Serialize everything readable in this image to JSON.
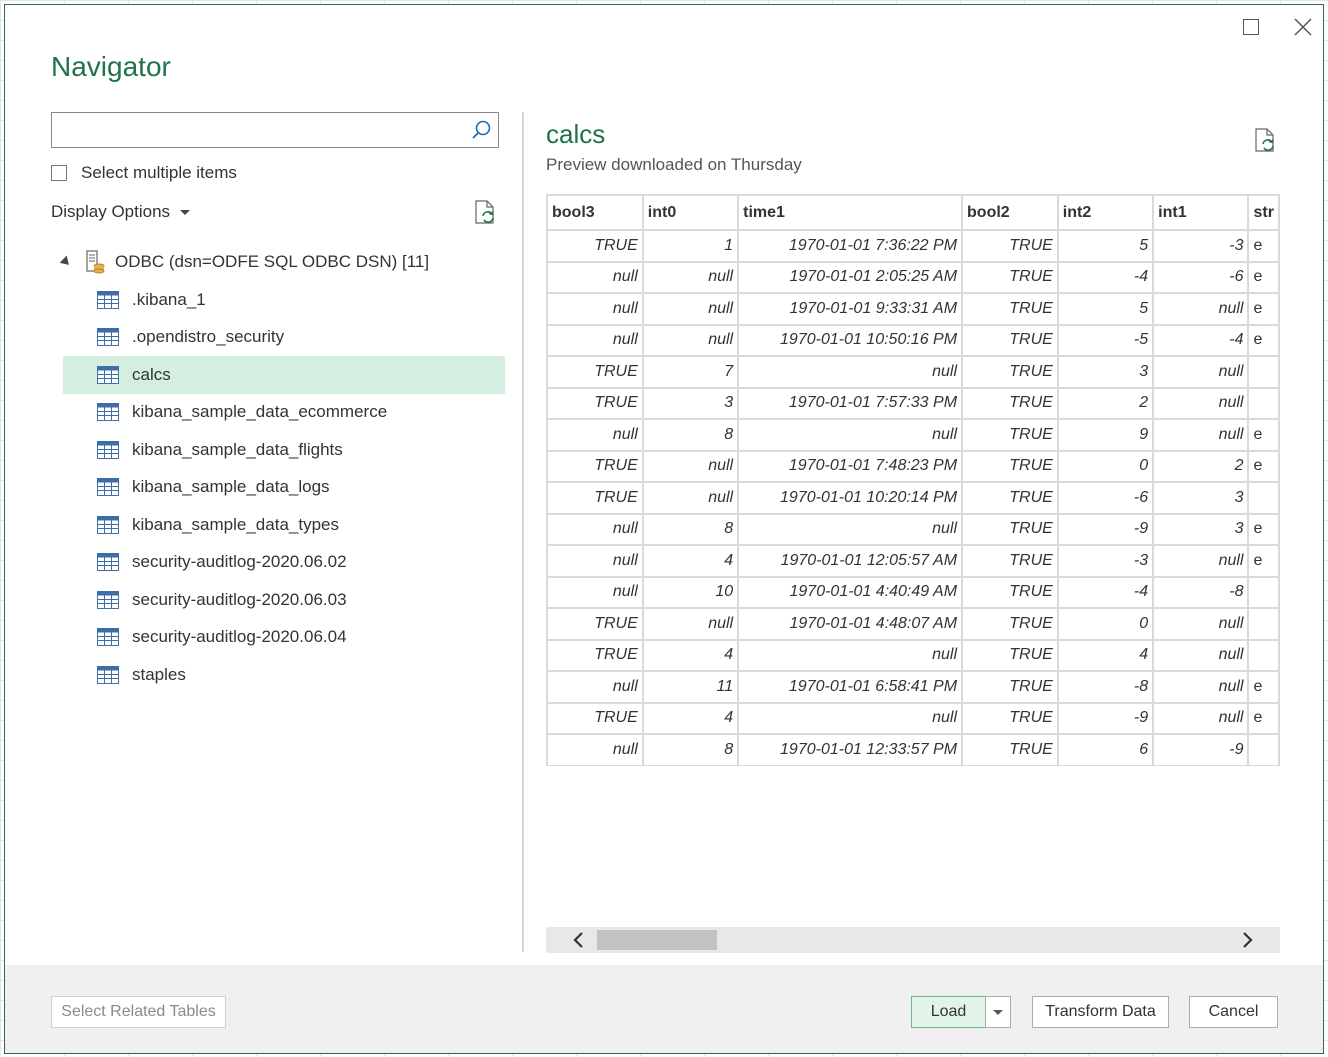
{
  "window": {
    "title": "Navigator"
  },
  "left": {
    "search_placeholder": "",
    "select_multiple_label": "Select multiple items",
    "display_options_label": "Display Options",
    "root_label": "ODBC (dsn=ODFE SQL ODBC DSN) [11]",
    "items": [
      {
        "label": ".kibana_1"
      },
      {
        "label": ".opendistro_security"
      },
      {
        "label": "calcs"
      },
      {
        "label": "kibana_sample_data_ecommerce"
      },
      {
        "label": "kibana_sample_data_flights"
      },
      {
        "label": "kibana_sample_data_logs"
      },
      {
        "label": "kibana_sample_data_types"
      },
      {
        "label": "security-auditlog-2020.06.02"
      },
      {
        "label": "security-auditlog-2020.06.03"
      },
      {
        "label": "security-auditlog-2020.06.04"
      },
      {
        "label": "staples"
      }
    ],
    "selected_index": 2
  },
  "preview": {
    "title": "calcs",
    "subtitle": "Preview downloaded on Thursday",
    "columns": [
      "bool3",
      "int0",
      "time1",
      "bool2",
      "int2",
      "int1",
      "str"
    ],
    "column_widths": [
      97,
      97,
      225,
      97,
      97,
      97,
      30
    ],
    "rows": [
      [
        "TRUE",
        "1",
        "1970-01-01 7:36:22 PM",
        "TRUE",
        "5",
        "-3",
        "e"
      ],
      [
        "null",
        "null",
        "1970-01-01 2:05:25 AM",
        "TRUE",
        "-4",
        "-6",
        "e"
      ],
      [
        "null",
        "null",
        "1970-01-01 9:33:31 AM",
        "TRUE",
        "5",
        "null",
        "e"
      ],
      [
        "null",
        "null",
        "1970-01-01 10:50:16 PM",
        "TRUE",
        "-5",
        "-4",
        "e"
      ],
      [
        "TRUE",
        "7",
        "null",
        "TRUE",
        "3",
        "null",
        ""
      ],
      [
        "TRUE",
        "3",
        "1970-01-01 7:57:33 PM",
        "TRUE",
        "2",
        "null",
        ""
      ],
      [
        "null",
        "8",
        "null",
        "TRUE",
        "9",
        "null",
        "e"
      ],
      [
        "TRUE",
        "null",
        "1970-01-01 7:48:23 PM",
        "TRUE",
        "0",
        "2",
        "e"
      ],
      [
        "TRUE",
        "null",
        "1970-01-01 10:20:14 PM",
        "TRUE",
        "-6",
        "3",
        ""
      ],
      [
        "null",
        "8",
        "null",
        "TRUE",
        "-9",
        "3",
        "e"
      ],
      [
        "null",
        "4",
        "1970-01-01 12:05:57 AM",
        "TRUE",
        "-3",
        "null",
        "e"
      ],
      [
        "null",
        "10",
        "1970-01-01 4:40:49 AM",
        "TRUE",
        "-4",
        "-8",
        ""
      ],
      [
        "TRUE",
        "null",
        "1970-01-01 4:48:07 AM",
        "TRUE",
        "0",
        "null",
        ""
      ],
      [
        "TRUE",
        "4",
        "null",
        "TRUE",
        "4",
        "null",
        ""
      ],
      [
        "null",
        "11",
        "1970-01-01 6:58:41 PM",
        "TRUE",
        "-8",
        "null",
        "e"
      ],
      [
        "TRUE",
        "4",
        "null",
        "TRUE",
        "-9",
        "null",
        "e"
      ],
      [
        "null",
        "8",
        "1970-01-01 12:33:57 PM",
        "TRUE",
        "6",
        "-9",
        ""
      ]
    ]
  },
  "footer": {
    "select_related_label": "Select Related Tables",
    "load_label": "Load",
    "transform_label": "Transform Data",
    "cancel_label": "Cancel"
  },
  "colors": {
    "accent": "#217346",
    "selected_row": "#d4efdf"
  }
}
